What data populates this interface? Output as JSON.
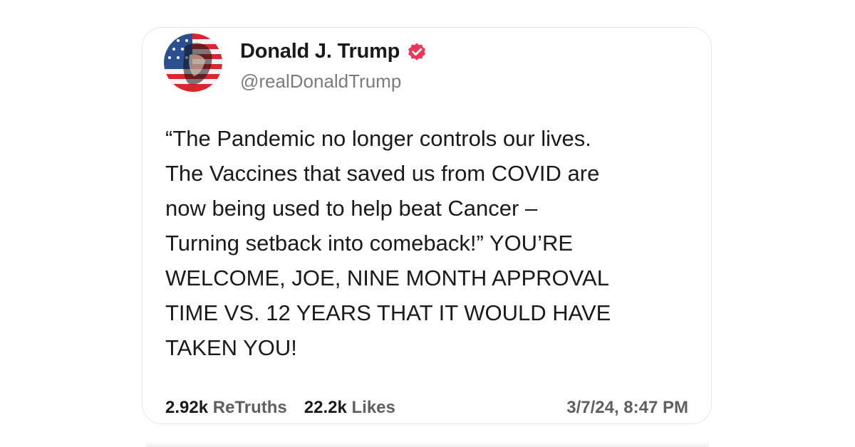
{
  "post": {
    "author": {
      "display_name": "Donald J. Trump",
      "handle": "@realDonaldTrump",
      "verified_icon": "verified-badge-icon",
      "avatar_icon": "flag-portrait-avatar"
    },
    "body_lines": [
      "“The Pandemic no longer controls our lives.",
      "The Vaccines that saved us from COVID are",
      "now being used to help beat Cancer –",
      "Turning setback into comeback!” YOU’RE",
      "WELCOME, JOE, NINE MONTH APPROVAL",
      "TIME VS. 12 YEARS THAT IT WOULD HAVE",
      "TAKEN YOU!"
    ],
    "stats": {
      "retruths_count": "2.92k",
      "retruths_label": "ReTruths",
      "likes_count": "22.2k",
      "likes_label": "Likes"
    },
    "timestamp": "3/7/24, 8:47 PM"
  },
  "colors": {
    "verified_badge": "#e8385a",
    "card_border": "#e6e6e6",
    "secondary_text": "#5f5f5f",
    "handle_text": "#7b7b7b"
  }
}
